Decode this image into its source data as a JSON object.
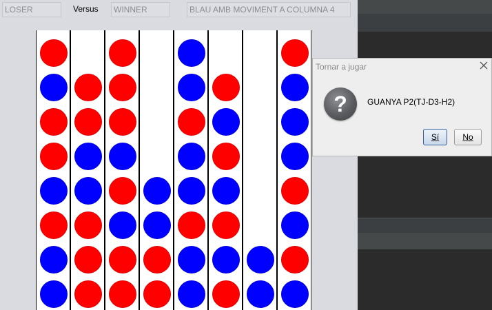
{
  "game": {
    "loser_text": "LOSER",
    "versus_label": "Versus",
    "winner_text": "WINNER",
    "status_text": "BLAU AMB MOVIMENT A COLUMNA 4"
  },
  "board": {
    "columns": 8,
    "rows": 8,
    "columns_top_to_bottom": [
      [
        "red",
        "blue",
        "red",
        "red",
        "blue",
        "red",
        "blue",
        "blue"
      ],
      [
        "",
        "red",
        "red",
        "blue",
        "blue",
        "red",
        "red",
        "red"
      ],
      [
        "red",
        "red",
        "red",
        "blue",
        "red",
        "blue",
        "red",
        "red"
      ],
      [
        "",
        "",
        "",
        "",
        "blue",
        "blue",
        "red",
        "red"
      ],
      [
        "blue",
        "blue",
        "red",
        "blue",
        "blue",
        "red",
        "blue",
        "blue"
      ],
      [
        "",
        "red",
        "blue",
        "red",
        "blue",
        "red",
        "blue",
        "red"
      ],
      [
        "",
        "",
        "",
        "",
        "",
        "",
        "blue",
        "blue"
      ],
      [
        "red",
        "blue",
        "blue",
        "blue",
        "red",
        "blue",
        "red",
        "blue"
      ]
    ]
  },
  "dialog": {
    "title": "Tornar a jugar",
    "message": "GUANYA P2(TJ-D3-H2)",
    "yes_label": "Sí",
    "no_label": "No",
    "icon": "question-icon"
  },
  "colors": {
    "red": "#ff0000",
    "blue": "#0000ff"
  }
}
